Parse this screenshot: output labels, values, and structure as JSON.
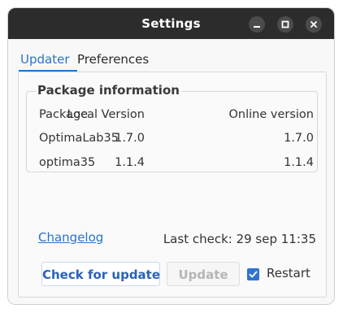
{
  "window": {
    "title": "Settings",
    "controls": [
      "minimize-icon",
      "maximize-icon",
      "close-icon"
    ]
  },
  "tabs": [
    {
      "label": "Updater",
      "active": true
    },
    {
      "label": "Preferences",
      "active": false
    }
  ],
  "package_info": {
    "title": "Package information",
    "columns": [
      "Package",
      "Local Version",
      "Online version"
    ],
    "rows": [
      {
        "package": "OptimaLab35",
        "local": "1.7.0",
        "online": "1.7.0"
      },
      {
        "package": "optima35",
        "local": "1.1.4",
        "online": "1.1.4"
      }
    ]
  },
  "footer": {
    "changelog": "Changelog",
    "last_check": "Last check: 29 sep 11:35"
  },
  "buttons": {
    "check": "Check for update",
    "update": "Update",
    "update_enabled": false
  },
  "restart": {
    "label": "Restart",
    "checked": true
  },
  "colors": {
    "titlebar": "#2c2c2c",
    "accent": "#2a73c9",
    "checkbox": "#2f74d0"
  }
}
